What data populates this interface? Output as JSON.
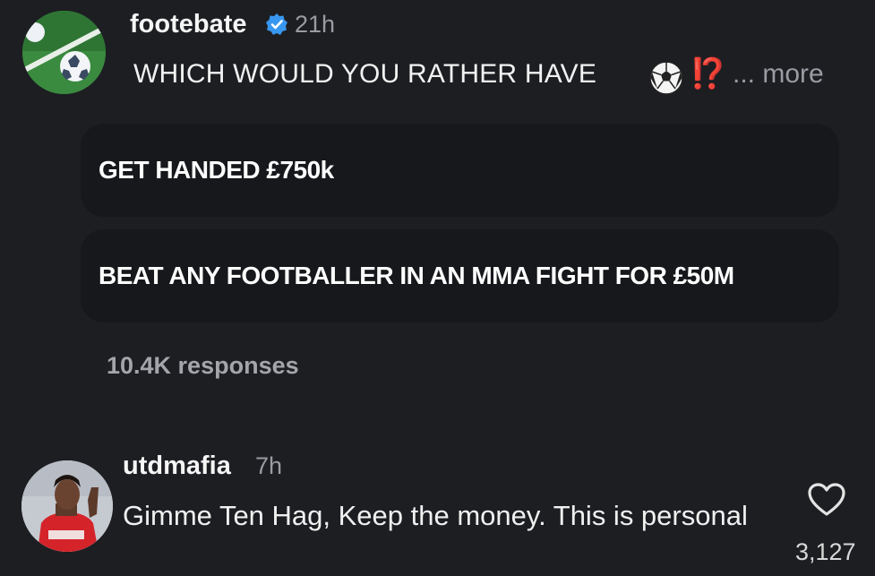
{
  "post": {
    "username": "footebate",
    "verified_icon": "verified-badge-icon",
    "time": "21h",
    "question": "WHICH WOULD YOU RATHER HAVE",
    "emoji_icon": "soccer-ball-icon",
    "exclaim": "⁉️",
    "more": "... more",
    "options": [
      {
        "label": "GET HANDED £750k"
      },
      {
        "label": "BEAT ANY FOOTBALLER IN AN MMA FIGHT FOR £50M"
      }
    ],
    "responses": "10.4K responses"
  },
  "comment": {
    "username": "utdmafia",
    "time": "7h",
    "text": "Gimme Ten Hag, Keep the money. This is personal",
    "like_icon": "heart-icon",
    "like_count": "3,127"
  },
  "colors": {
    "background": "#1d1e22",
    "option_bg": "#17181b",
    "muted_text": "#9a9ca3",
    "verified": "#3897f0",
    "exclaim": "#e0342a"
  }
}
